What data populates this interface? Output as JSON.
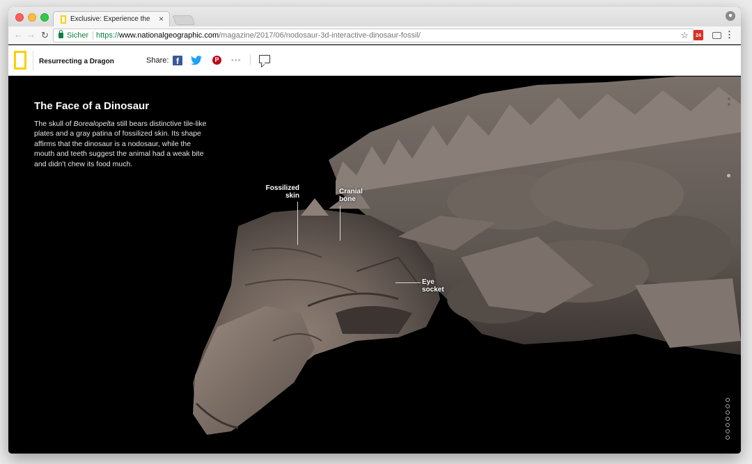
{
  "browser": {
    "tab_title": "Exclusive: Experience the Best",
    "tab_close": "×",
    "secure_label": "Sicher",
    "url_scheme": "https://",
    "url_host": "www.nationalgeographic.com",
    "url_path": "/magazine/2017/06/nodosaur-3d-interactive-dinosaur-fossil/",
    "calendar_day": "24"
  },
  "header": {
    "story_title": "Resurrecting a Dragon",
    "share_label": "Share:",
    "facebook_glyph": "f",
    "twitter_glyph": "🐦",
    "pinterest_glyph": "P",
    "more_glyph": "•••"
  },
  "intro": {
    "title": "The Face of a Dinosaur",
    "body_before": "The skull of ",
    "body_italic": "Borealopelta",
    "body_after": " still bears distinctive tile-like plates and a gray patina of fossilized skin. Its shape affirms that the dinosaur is a nodosaur, while the mouth and teeth suggest the animal had a weak bite and didn’t chew its food much."
  },
  "callouts": {
    "fossilized_skin": "Fossilized skin",
    "cranial_bone": "Cranial bone",
    "eye_socket": "Eye socket"
  },
  "icons": {
    "browser": [
      "close-icon",
      "back-arrow-icon",
      "forward-arrow-icon",
      "reload-icon",
      "lock-icon",
      "star-icon",
      "cast-icon",
      "menu-icon",
      "profile-icon"
    ],
    "site": [
      "natgeo-logo-icon",
      "facebook-icon",
      "twitter-icon",
      "pinterest-icon",
      "more-icon",
      "comment-icon"
    ]
  },
  "colors": {
    "natgeo_yellow": "#ffce00",
    "secure_green": "#0b8043",
    "facebook_blue": "#3b5998",
    "twitter_blue": "#1da1f2",
    "pinterest_red": "#bd081c",
    "background": "#000000"
  }
}
